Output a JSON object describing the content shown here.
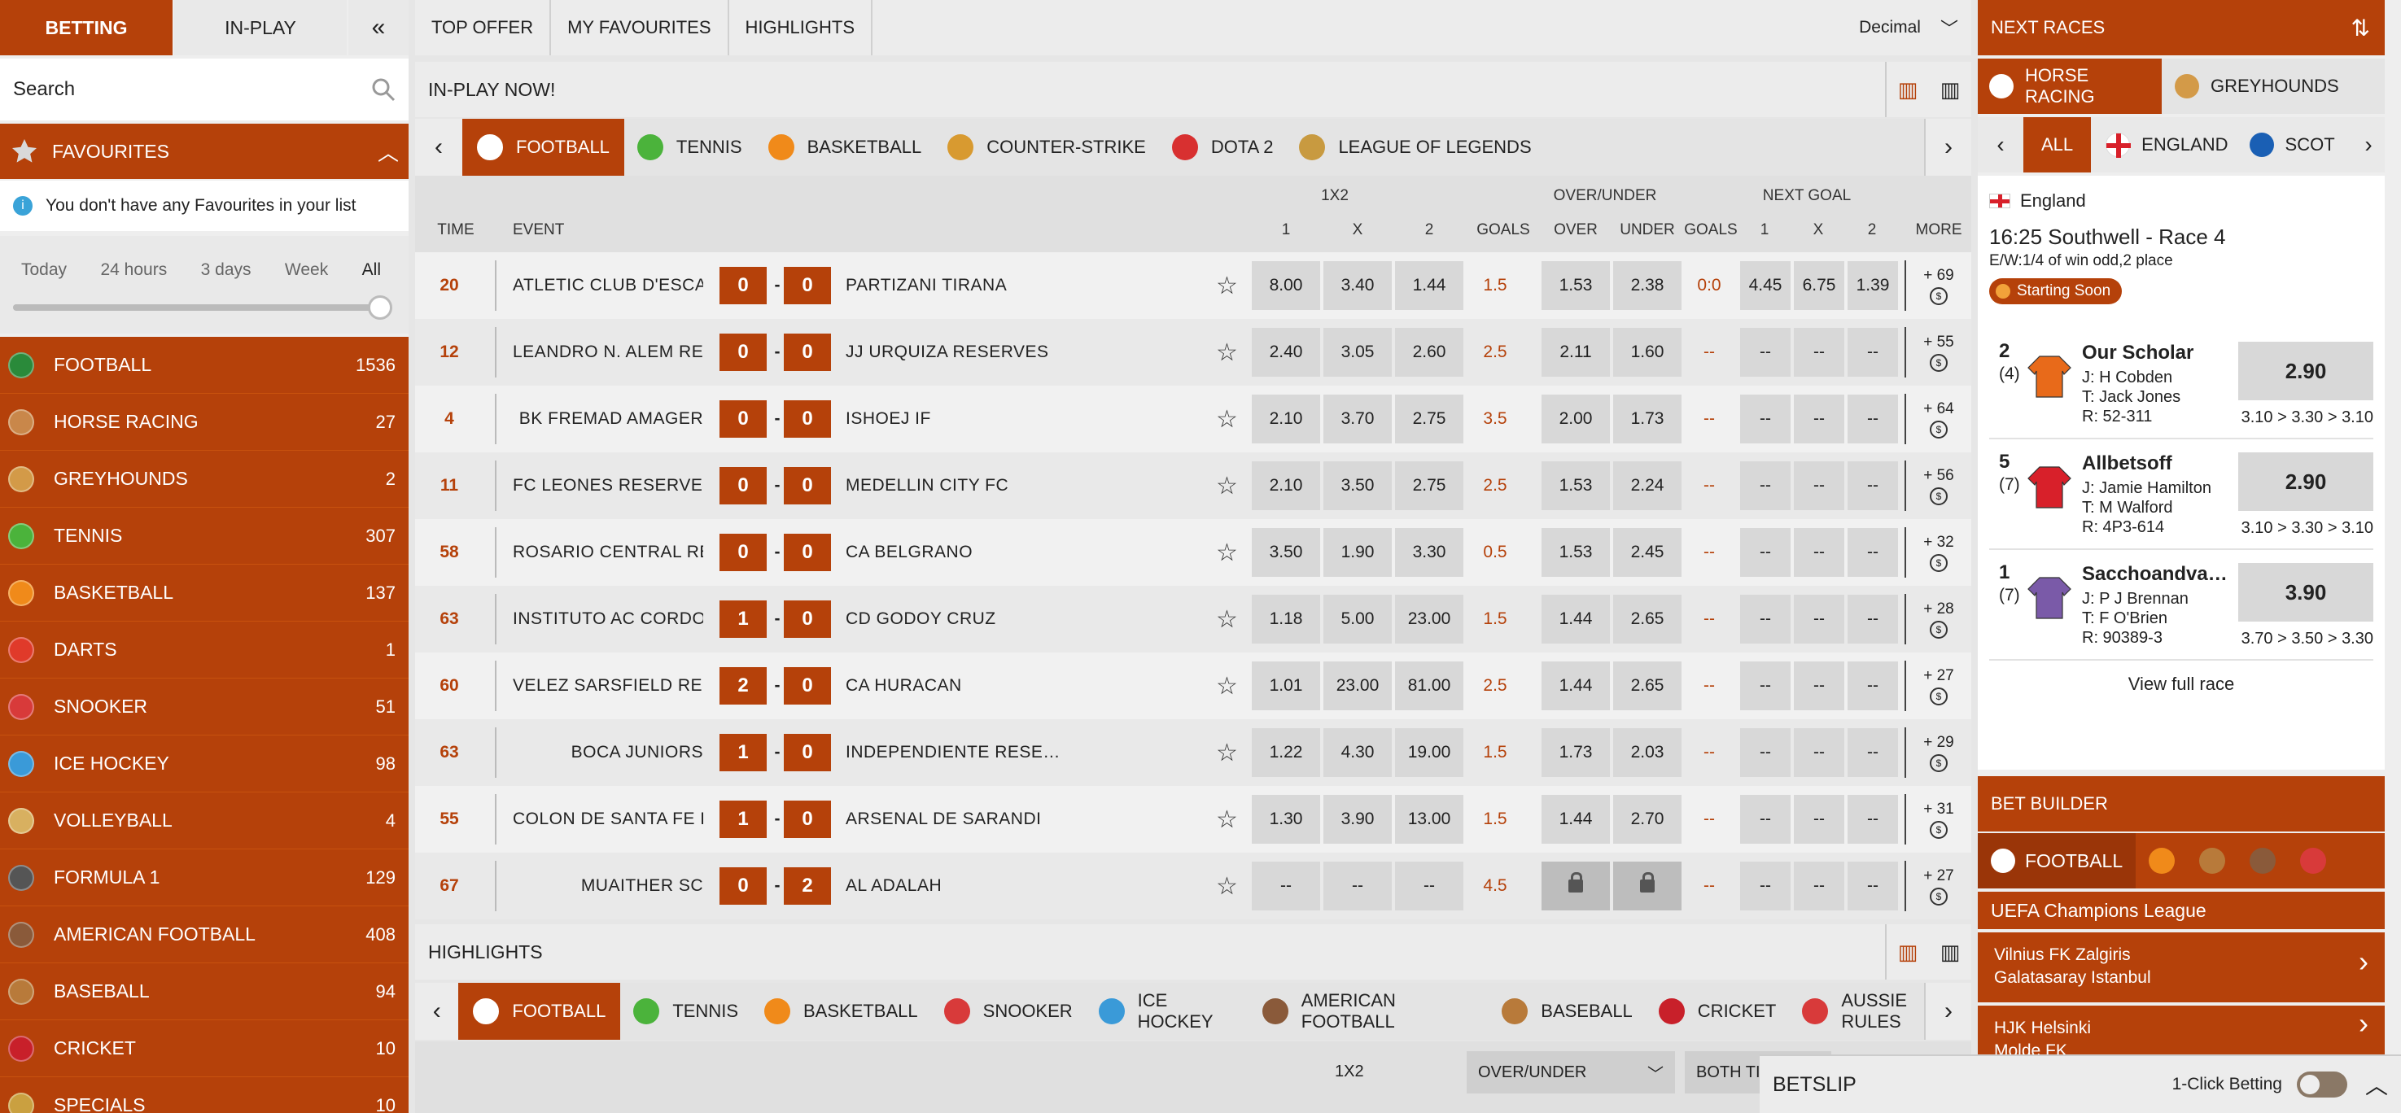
{
  "left": {
    "tabs": [
      "BETTING",
      "IN-PLAY"
    ],
    "search_placeholder": "Search",
    "favourites_title": "FAVOURITES",
    "favourites_note": "You don't have any Favourites in your list",
    "time_filters": [
      "Today",
      "24 hours",
      "3 days",
      "Week",
      "All"
    ],
    "time_filter_selected": "All",
    "sports": [
      {
        "name": "FOOTBALL",
        "count": "1536",
        "icon": "football-icon",
        "color": "#2a8a3a"
      },
      {
        "name": "HORSE RACING",
        "count": "27",
        "icon": "horse-icon",
        "color": "#c9874a"
      },
      {
        "name": "GREYHOUNDS",
        "count": "2",
        "icon": "greyhound-icon",
        "color": "#d39a48"
      },
      {
        "name": "TENNIS",
        "count": "307",
        "icon": "tennis-icon",
        "color": "#4bb33b"
      },
      {
        "name": "BASKETBALL",
        "count": "137",
        "icon": "basketball-icon",
        "color": "#f08a1a"
      },
      {
        "name": "DARTS",
        "count": "1",
        "icon": "darts-icon",
        "color": "#e03a2a"
      },
      {
        "name": "SNOOKER",
        "count": "51",
        "icon": "snooker-icon",
        "color": "#d83a3a"
      },
      {
        "name": "ICE HOCKEY",
        "count": "98",
        "icon": "ice-hockey-icon",
        "color": "#3a9ad8"
      },
      {
        "name": "VOLLEYBALL",
        "count": "4",
        "icon": "volleyball-icon",
        "color": "#d8b060"
      },
      {
        "name": "FORMULA 1",
        "count": "129",
        "icon": "formula1-icon",
        "color": "#555555"
      },
      {
        "name": "AMERICAN FOOTBALL",
        "count": "408",
        "icon": "american-football-icon",
        "color": "#8a5a3a"
      },
      {
        "name": "BASEBALL",
        "count": "94",
        "icon": "baseball-icon",
        "color": "#b87a3a"
      },
      {
        "name": "CRICKET",
        "count": "10",
        "icon": "cricket-icon",
        "color": "#c8202a"
      },
      {
        "name": "SPECIALS",
        "count": "10",
        "icon": "specials-icon",
        "color": "#caa040"
      }
    ]
  },
  "main": {
    "top_tabs": [
      "TOP OFFER",
      "MY FAVOURITES",
      "HIGHLIGHTS"
    ],
    "odds_format": "Decimal",
    "inplay_title": "IN-PLAY NOW!",
    "inplay_sports": [
      {
        "name": "FOOTBALL",
        "icon": "football-icon",
        "color": "#ffffff"
      },
      {
        "name": "TENNIS",
        "icon": "tennis-icon",
        "color": "#4bb33b"
      },
      {
        "name": "BASKETBALL",
        "icon": "basketball-icon",
        "color": "#f08a1a"
      },
      {
        "name": "COUNTER-STRIKE",
        "icon": "counter-strike-icon",
        "color": "#d89a30"
      },
      {
        "name": "DOTA 2",
        "icon": "dota2-icon",
        "color": "#d83030"
      },
      {
        "name": "LEAGUE OF LEGENDS",
        "icon": "lol-icon",
        "color": "#c89a40"
      }
    ],
    "columns": {
      "group_1x2": "1X2",
      "group_ou": "OVER/UNDER",
      "group_ng": "NEXT GOAL",
      "time": "TIME",
      "event": "EVENT",
      "c1": "1",
      "cx": "X",
      "c2": "2",
      "goals": "GOALS",
      "over": "OVER",
      "under": "UNDER",
      "ng_goals": "GOALS",
      "ng1": "1",
      "ngx": "X",
      "ng2": "2",
      "more": "MORE"
    },
    "matches": [
      {
        "time": "20",
        "home": "ATLETIC CLUB D'ESCA…",
        "hs": "0",
        "as": "0",
        "away": "PARTIZANI TIRANA",
        "o1": "8.00",
        "ox": "3.40",
        "o2": "1.44",
        "goals": "1.5",
        "over": "1.53",
        "under": "2.38",
        "ng_goals": "0:0",
        "ng1": "4.45",
        "ngx": "6.75",
        "ng2": "1.39",
        "more": "+ 69"
      },
      {
        "time": "12",
        "home": "LEANDRO N. ALEM RE…",
        "hs": "0",
        "as": "0",
        "away": "JJ URQUIZA RESERVES",
        "o1": "2.40",
        "ox": "3.05",
        "o2": "2.60",
        "goals": "2.5",
        "over": "2.11",
        "under": "1.60",
        "ng_goals": "--",
        "ng1": "--",
        "ngx": "--",
        "ng2": "--",
        "more": "+ 55"
      },
      {
        "time": "4",
        "home": "BK FREMAD AMAGER",
        "hs": "0",
        "as": "0",
        "away": "ISHOEJ IF",
        "o1": "2.10",
        "ox": "3.70",
        "o2": "2.75",
        "goals": "3.5",
        "over": "2.00",
        "under": "1.73",
        "ng_goals": "--",
        "ng1": "--",
        "ngx": "--",
        "ng2": "--",
        "more": "+ 64"
      },
      {
        "time": "11",
        "home": "FC LEONES RESERVES",
        "hs": "0",
        "as": "0",
        "away": "MEDELLIN CITY FC",
        "o1": "2.10",
        "ox": "3.50",
        "o2": "2.75",
        "goals": "2.5",
        "over": "1.53",
        "under": "2.24",
        "ng_goals": "--",
        "ng1": "--",
        "ngx": "--",
        "ng2": "--",
        "more": "+ 56"
      },
      {
        "time": "58",
        "home": "ROSARIO CENTRAL RE…",
        "hs": "0",
        "as": "0",
        "away": "CA BELGRANO",
        "o1": "3.50",
        "ox": "1.90",
        "o2": "3.30",
        "goals": "0.5",
        "over": "1.53",
        "under": "2.45",
        "ng_goals": "--",
        "ng1": "--",
        "ngx": "--",
        "ng2": "--",
        "more": "+ 32"
      },
      {
        "time": "63",
        "home": "INSTITUTO AC CORDO…",
        "hs": "1",
        "as": "0",
        "away": "CD GODOY CRUZ",
        "o1": "1.18",
        "ox": "5.00",
        "o2": "23.00",
        "goals": "1.5",
        "over": "1.44",
        "under": "2.65",
        "ng_goals": "--",
        "ng1": "--",
        "ngx": "--",
        "ng2": "--",
        "more": "+ 28"
      },
      {
        "time": "60",
        "home": "VELEZ SARSFIELD RES…",
        "hs": "2",
        "as": "0",
        "away": "CA HURACAN",
        "o1": "1.01",
        "ox": "23.00",
        "o2": "81.00",
        "goals": "2.5",
        "over": "1.44",
        "under": "2.65",
        "ng_goals": "--",
        "ng1": "--",
        "ngx": "--",
        "ng2": "--",
        "more": "+ 27"
      },
      {
        "time": "63",
        "home": "BOCA JUNIORS",
        "hs": "1",
        "as": "0",
        "away": "INDEPENDIENTE RESE…",
        "o1": "1.22",
        "ox": "4.30",
        "o2": "19.00",
        "goals": "1.5",
        "over": "1.73",
        "under": "2.03",
        "ng_goals": "--",
        "ng1": "--",
        "ngx": "--",
        "ng2": "--",
        "more": "+ 29"
      },
      {
        "time": "55",
        "home": "COLON DE SANTA FE R…",
        "hs": "1",
        "as": "0",
        "away": "ARSENAL DE SARANDI",
        "o1": "1.30",
        "ox": "3.90",
        "o2": "13.00",
        "goals": "1.5",
        "over": "1.44",
        "under": "2.70",
        "ng_goals": "--",
        "ng1": "--",
        "ngx": "--",
        "ng2": "--",
        "more": "+ 31"
      },
      {
        "time": "67",
        "home": "MUAITHER SC",
        "hs": "0",
        "as": "2",
        "away": "AL ADALAH",
        "o1": "--",
        "ox": "--",
        "o2": "--",
        "goals": "4.5",
        "over": "lock",
        "under": "lock",
        "ng_goals": "--",
        "ng1": "--",
        "ngx": "--",
        "ng2": "--",
        "more": "+ 27"
      }
    ],
    "highlights_title": "HIGHLIGHTS",
    "highlight_sports": [
      {
        "name": "FOOTBALL",
        "icon": "football-icon",
        "color": "#ffffff"
      },
      {
        "name": "TENNIS",
        "icon": "tennis-icon",
        "color": "#4bb33b"
      },
      {
        "name": "BASKETBALL",
        "icon": "basketball-icon",
        "color": "#f08a1a"
      },
      {
        "name": "SNOOKER",
        "icon": "snooker-icon",
        "color": "#d83a3a"
      },
      {
        "name": "ICE HOCKEY",
        "icon": "ice-hockey-icon",
        "color": "#3a9ad8"
      },
      {
        "name": "AMERICAN FOOTBALL",
        "icon": "american-football-icon",
        "color": "#8a5a3a"
      },
      {
        "name": "BASEBALL",
        "icon": "baseball-icon",
        "color": "#b87a3a"
      },
      {
        "name": "CRICKET",
        "icon": "cricket-icon",
        "color": "#c8202a"
      },
      {
        "name": "AUSSIE RULES",
        "icon": "aussie-rules-icon",
        "color": "#d83a3a"
      }
    ],
    "hl_group_1x2": "1X2",
    "hl_ou_select": "OVER/UNDER",
    "hl_both": "BOTH TI"
  },
  "right": {
    "next_races_title": "NEXT RACES",
    "race_tabs": [
      "HORSE RACING",
      "GREYHOUNDS"
    ],
    "region_tabs": [
      "ALL",
      "ENGLAND",
      "SCOT"
    ],
    "race_country": "England",
    "race_title": "16:25  Southwell - Race 4",
    "race_terms": "E/W:1/4 of win odd,2 place",
    "race_status": "Starting Soon",
    "runners": [
      {
        "num": "2",
        "draw": "(4)",
        "name": "Our Scholar",
        "jockey": "J: H Cobden",
        "trainer": "T: Jack Jones",
        "rating": "R: 52-311",
        "price": "2.90",
        "history": "3.10 > 3.30 > 3.10",
        "silk": "#e86a1a"
      },
      {
        "num": "5",
        "draw": "(7)",
        "name": "Allbetsoff",
        "jockey": "J: Jamie Hamilton",
        "trainer": "T: M Walford",
        "rating": "R: 4P3-614",
        "price": "2.90",
        "history": "3.10 > 3.30 > 3.10",
        "silk": "#d8202a"
      },
      {
        "num": "1",
        "draw": "(7)",
        "name": "Sacchoandva…",
        "jockey": "J: P J Brennan",
        "trainer": "T: F O'Brien",
        "rating": "R: 90389-3",
        "price": "3.90",
        "history": "3.70 > 3.50 > 3.30",
        "silk": "#7a5aa8"
      }
    ],
    "view_full_race": "View full race",
    "bet_builder_title": "BET BUILDER",
    "bb_sport": "FOOTBALL",
    "bb_league": "UEFA Champions League",
    "bb_matches": [
      {
        "home": "Vilnius FK Zalgiris",
        "away": "Galatasaray Istanbul"
      },
      {
        "home": "HJK Helsinki",
        "away": "Molde FK"
      }
    ]
  },
  "betslip": {
    "title": "BETSLIP",
    "one_click": "1-Click Betting"
  },
  "colors": {
    "accent": "#b5410a",
    "panel": "#eeeeee"
  }
}
